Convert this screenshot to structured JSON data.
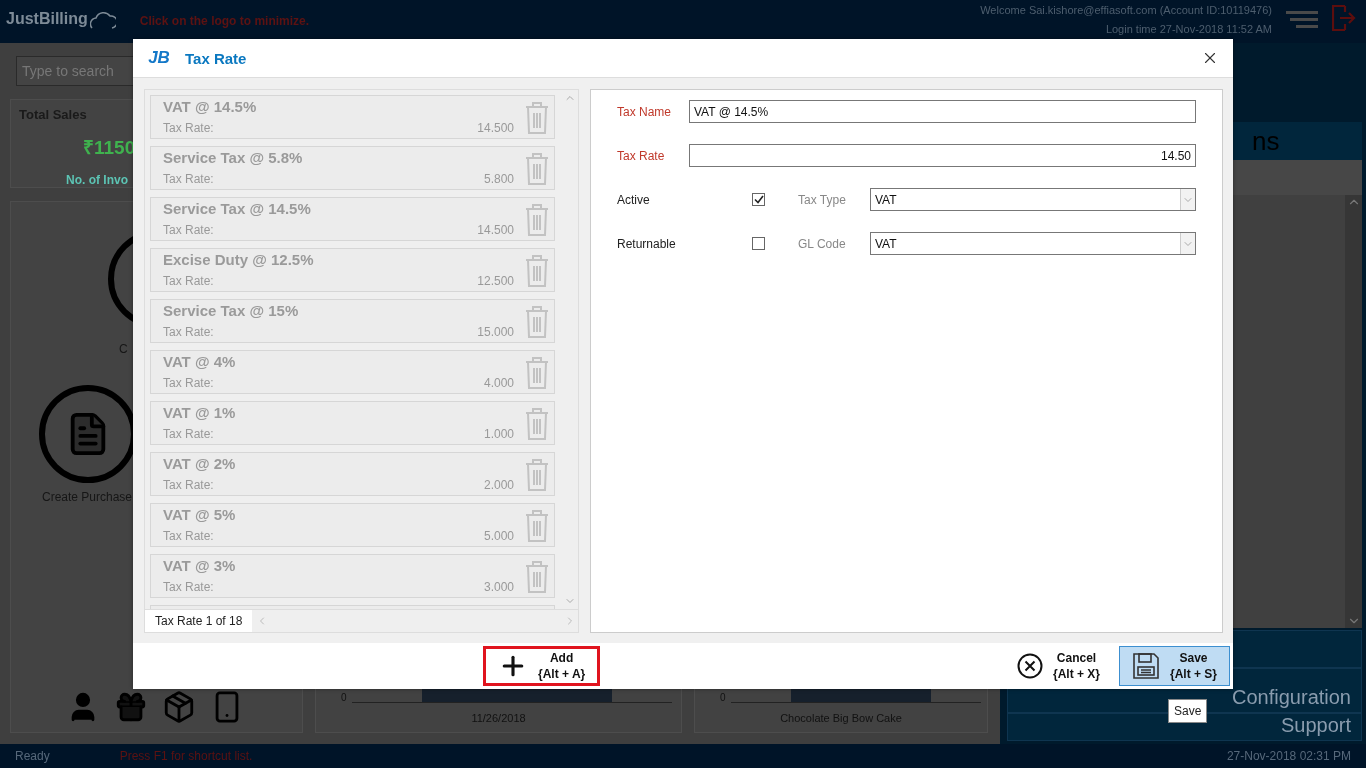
{
  "header": {
    "logo": "JustBilling",
    "hint": "Click on the logo to minimize.",
    "welcome": "Welcome Sai.kishore@effiasoft.com (Account ID:10119476)",
    "login_time": "Login time  27-Nov-2018 11:52 AM"
  },
  "left_panel": {
    "search": {
      "placeholder": "Type to search"
    },
    "total_sales": {
      "title": "Total Sales",
      "amount": "₹1150",
      "invoices_label": "No. of Invo"
    },
    "actions": [
      {
        "label": "C"
      },
      {
        "label": "Create Purchase"
      }
    ]
  },
  "charts": [
    {
      "tick": "0",
      "category": "11/26/2018"
    },
    {
      "tick": "0",
      "category": "Chocolate Big Bow Cake"
    }
  ],
  "right_panel": {
    "heading": "ns",
    "menu": [
      "Configuration",
      "Support"
    ]
  },
  "status_bar": {
    "status": "Ready",
    "hint": "Press F1 for shortcut list.",
    "datetime": "27-Nov-2018 02:31 PM"
  },
  "dialog": {
    "logo": "JB",
    "title": "Tax Rate",
    "items": [
      {
        "name": "VAT @ 14.5%",
        "rate_label": "Tax Rate:",
        "rate": "14.500"
      },
      {
        "name": "Service Tax @ 5.8%",
        "rate_label": "Tax Rate:",
        "rate": "5.800"
      },
      {
        "name": "Service Tax @ 14.5%",
        "rate_label": "Tax Rate:",
        "rate": "14.500"
      },
      {
        "name": "Excise Duty @ 12.5%",
        "rate_label": "Tax Rate:",
        "rate": "12.500"
      },
      {
        "name": "Service Tax @ 15%",
        "rate_label": "Tax Rate:",
        "rate": "15.000"
      },
      {
        "name": "VAT @ 4%",
        "rate_label": "Tax Rate:",
        "rate": "4.000"
      },
      {
        "name": "VAT @ 1%",
        "rate_label": "Tax Rate:",
        "rate": "1.000"
      },
      {
        "name": "VAT @ 2%",
        "rate_label": "Tax Rate:",
        "rate": "2.000"
      },
      {
        "name": "VAT @ 5%",
        "rate_label": "Tax Rate:",
        "rate": "5.000"
      },
      {
        "name": "VAT @ 3%",
        "rate_label": "Tax Rate:",
        "rate": "3.000"
      }
    ],
    "pager": "Tax Rate 1 of 18",
    "form": {
      "tax_name": {
        "label": "Tax Name",
        "value": "VAT @ 14.5%"
      },
      "tax_rate": {
        "label": "Tax Rate",
        "value": "14.50"
      },
      "active": {
        "label": "Active",
        "checked": true
      },
      "tax_type": {
        "label": "Tax Type",
        "value": "VAT"
      },
      "returnable": {
        "label": "Returnable",
        "checked": false
      },
      "gl_code": {
        "label": "GL Code",
        "value": "VAT"
      }
    },
    "buttons": [
      {
        "kind": "add",
        "label": "Add",
        "shortcut": "{Alt + A}",
        "marked": true,
        "focused": false
      },
      {
        "kind": "cancel",
        "label": "Cancel",
        "shortcut": "{Alt + X}",
        "marked": false,
        "focused": false
      },
      {
        "kind": "save",
        "label": "Save",
        "shortcut": "{Alt + S}",
        "marked": false,
        "focused": true
      }
    ],
    "tooltip": "Save"
  }
}
